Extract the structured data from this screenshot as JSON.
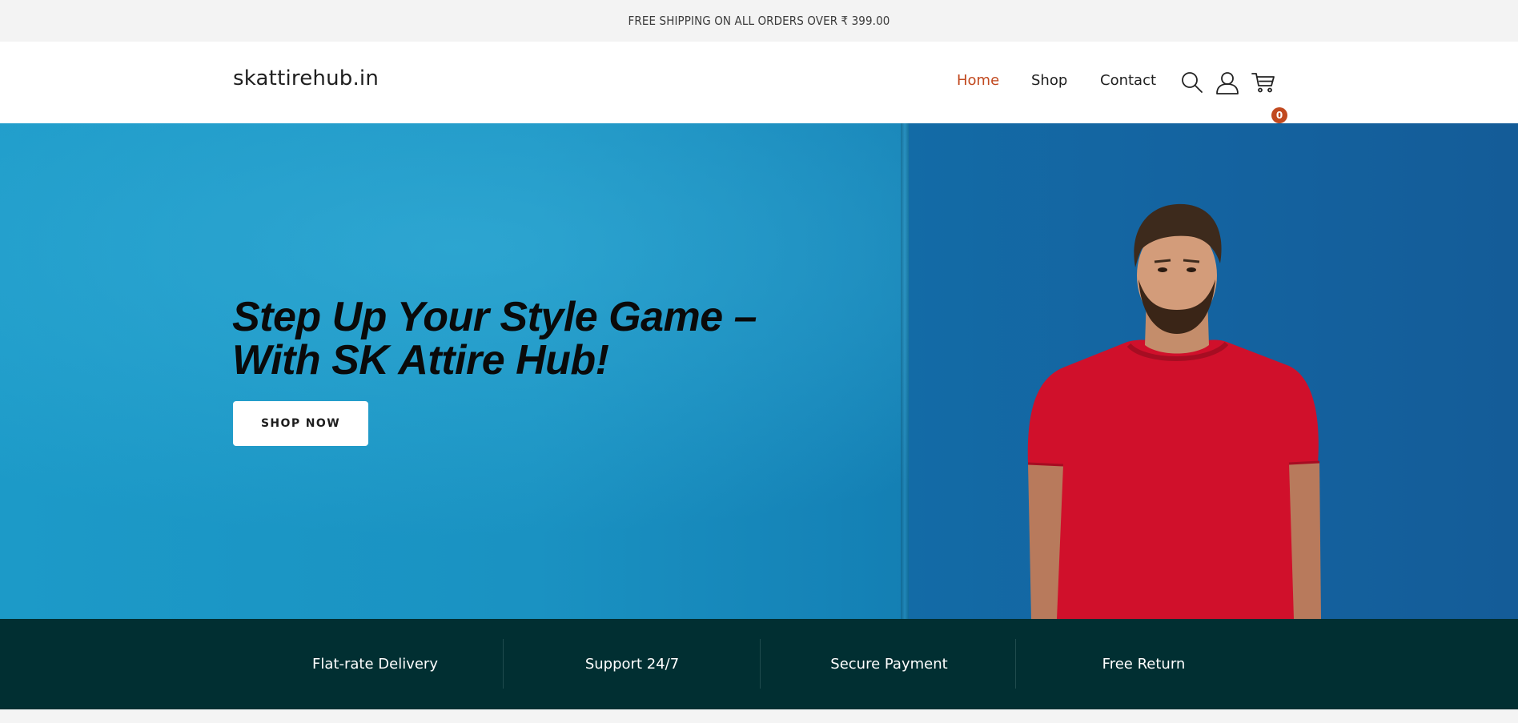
{
  "announcement": {
    "text": "FREE SHIPPING ON ALL ORDERS OVER ₹ 399.00"
  },
  "header": {
    "logo": "skattirehub.in",
    "nav": [
      {
        "label": "Home",
        "active": true
      },
      {
        "label": "Shop",
        "active": false
      },
      {
        "label": "Contact",
        "active": false
      }
    ],
    "icons": [
      "search-icon",
      "user-icon",
      "cart-icon"
    ],
    "cart_count": "0"
  },
  "hero": {
    "title_line1": "Step Up Your Style Game –",
    "title_line2": "With SK Attire Hub!",
    "button": "SHOP NOW"
  },
  "features": [
    {
      "label": "Flat-rate Delivery"
    },
    {
      "label": "Support 24/7"
    },
    {
      "label": "Secure Payment"
    },
    {
      "label": "Free Return"
    }
  ],
  "colors": {
    "accent": "#c1491f",
    "features_bg": "#012f32",
    "hero_blue": "#1a92c2",
    "shirt_red": "#d0102b"
  }
}
